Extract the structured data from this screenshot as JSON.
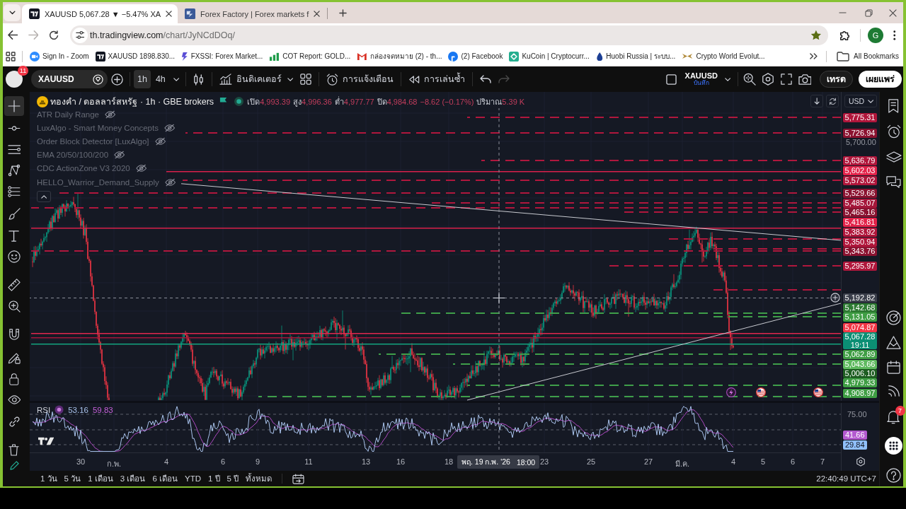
{
  "browser": {
    "tabs": [
      {
        "title": "XAUUSD 5,067.28 ▼ −5.47% XA",
        "selected": true
      },
      {
        "title": "Forex Factory | Forex markets f",
        "selected": false
      }
    ],
    "navigation": {
      "forward_disabled": true
    },
    "address": {
      "host": "th.tradingview.com",
      "path": "/chart/JyNCdDOq/",
      "bookmarked": true
    },
    "profile_initial": "G",
    "bookmarks": [
      {
        "label": "Sign In - Zoom"
      },
      {
        "label": "XAUUSD 1898.830..."
      },
      {
        "label": "FXSSI: Forex Market..."
      },
      {
        "label": "COT Report: GOLD..."
      },
      {
        "label": "กล่องจดหมาย (2) - th..."
      },
      {
        "label": "(2) Facebook"
      },
      {
        "label": "KuCoin | Cryptocurr..."
      },
      {
        "label": "Huobi Russia | ระบบ..."
      },
      {
        "label": "Crypto World Evolut..."
      }
    ],
    "all_bookmarks": "All Bookmarks"
  },
  "toolbar": {
    "notification_count": "11",
    "symbol": "XAUUSD",
    "intervals": [
      {
        "label": "1h",
        "selected": true
      },
      {
        "label": "4h",
        "selected": false
      }
    ],
    "indicators_label": "อินดิเคเตอร์",
    "alerts_label": "การแจ้งเตือน",
    "replay_label": "การเล่นซ้ำ",
    "redo_disabled": true,
    "layout": {
      "name": "XAUUSD",
      "status": "บันทึก"
    },
    "trade_label": "เทรด",
    "publish_label": "เผยแพร่"
  },
  "drawing_tools": [
    {
      "selected": true
    },
    {
      "selected": false
    },
    {
      "selected": false
    },
    {
      "selected": false
    },
    {
      "selected": false
    },
    {
      "selected": false
    },
    {
      "selected": false
    },
    {
      "selected": false
    },
    {
      "selected": false
    },
    {
      "selected": false
    },
    {
      "selected": false
    },
    {
      "selected": false
    },
    {
      "selected": false
    },
    {
      "selected": false
    },
    {
      "selected": false
    },
    {
      "selected": false
    },
    {
      "selected": false
    }
  ],
  "chart": {
    "legend": {
      "title": "ทองคำ / ดอลลาร์สหรัฐ · 1h · GBE brokers",
      "market_open": true,
      "ohlc": [
        {
          "label": "เปิด",
          "value": "4,993.39"
        },
        {
          "label": "สูง",
          "value": "4,996.36"
        },
        {
          "label": "ต่ำ",
          "value": "4,977.77"
        },
        {
          "label": "ปิด",
          "value": "4,984.68"
        }
      ],
      "change": "−8.62 (−0.17%)",
      "volume_label": "ปริมาณ",
      "volume": "5.39 K"
    },
    "indicators": [
      {
        "name": "ATR Daily Range",
        "visible": false
      },
      {
        "name": "LuxAlgo - Smart Money Concepts",
        "visible": false
      },
      {
        "name": "Order Block Detector [LuxAlgo]",
        "visible": false
      },
      {
        "name": "EMA 20/50/100/200",
        "visible": false
      },
      {
        "name": "CDC ActionZone V3 2020",
        "visible": false
      },
      {
        "name": "HELLO_Warrior_Demand_Supply",
        "visible": false
      }
    ],
    "currency": "USD",
    "price_labels": [
      {
        "kind": "level",
        "text": "5,775.31",
        "color": "#b0163b"
      },
      {
        "kind": "level",
        "text": "5,726.94",
        "color": "#8b1230"
      },
      {
        "kind": "tick",
        "text": "5,700.00"
      },
      {
        "kind": "level",
        "text": "5,636.79",
        "color": "#b0163b"
      },
      {
        "kind": "level",
        "text": "5,602.03",
        "color": "#e3234a"
      },
      {
        "kind": "level",
        "text": "5,573.02",
        "color": "#b0163b"
      },
      {
        "kind": "level",
        "text": "5,529.66",
        "color": "#8b1230"
      },
      {
        "kind": "level",
        "text": "5,485.07",
        "color": "#a5163a"
      },
      {
        "kind": "level",
        "text": "5,465.16",
        "color": "#8b1230"
      },
      {
        "kind": "level",
        "text": "5,416.81",
        "color": "#e3234a"
      },
      {
        "kind": "level",
        "text": "5,383.92",
        "color": "#b0163b"
      },
      {
        "kind": "level",
        "text": "5,350.94",
        "color": "#b0163b"
      },
      {
        "kind": "level",
        "text": "5,343.76",
        "color": "#8b1230"
      },
      {
        "kind": "level",
        "text": "5,295.97",
        "color": "#b0163b"
      },
      {
        "kind": "crosshair",
        "text": "5,192.82"
      },
      {
        "kind": "level",
        "text": "5,142.68",
        "color": "#2d7a32"
      },
      {
        "kind": "level",
        "text": "5,131.05",
        "color": "#3f9e44"
      },
      {
        "kind": "level",
        "text": "5,074.87",
        "color": "#f23645"
      },
      {
        "kind": "current",
        "text": "5,067.28",
        "countdown": "19:11",
        "color": "#0b8f74"
      },
      {
        "kind": "level",
        "text": "5,062.89",
        "color": "#3f9e44"
      },
      {
        "kind": "level",
        "text": "5,043.66",
        "color": "#5fba5f"
      },
      {
        "kind": "level",
        "text": "5,006.10",
        "color": "#1e5e22"
      },
      {
        "kind": "level",
        "text": "4,979.33",
        "color": "#3f9e44"
      },
      {
        "kind": "level",
        "text": "4,908.97",
        "color": "#3f9e44"
      }
    ],
    "rsi": {
      "title": "RSI",
      "value": "53.16",
      "average": "59.83",
      "labels": [
        {
          "kind": "tick",
          "text": "75.00"
        },
        {
          "kind": "level",
          "text": "41.66",
          "color": "#b45ad0"
        },
        {
          "kind": "level",
          "text": "29.84",
          "color": "#90bff9"
        }
      ]
    },
    "time_labels": [
      "30",
      "ก.พ.",
      "4",
      "6",
      "9",
      "11",
      "13",
      "16",
      "18",
      "23",
      "25",
      "27",
      "มี.ค.",
      "4",
      "5",
      "6",
      "7"
    ],
    "crosshair_time": {
      "date": "พฤ. 19 ก.พ. '26",
      "time": "18:00"
    }
  },
  "time_ranges": [
    "1 วัน",
    "5 วัน",
    "1 เดือน",
    "3 เดือน",
    "6 เดือน",
    "YTD",
    "1 ปี",
    "5 ปี",
    "ทั้งหมด"
  ],
  "clock": "22:40:49 UTC+7",
  "sidebar": {
    "alert_count": "7"
  }
}
